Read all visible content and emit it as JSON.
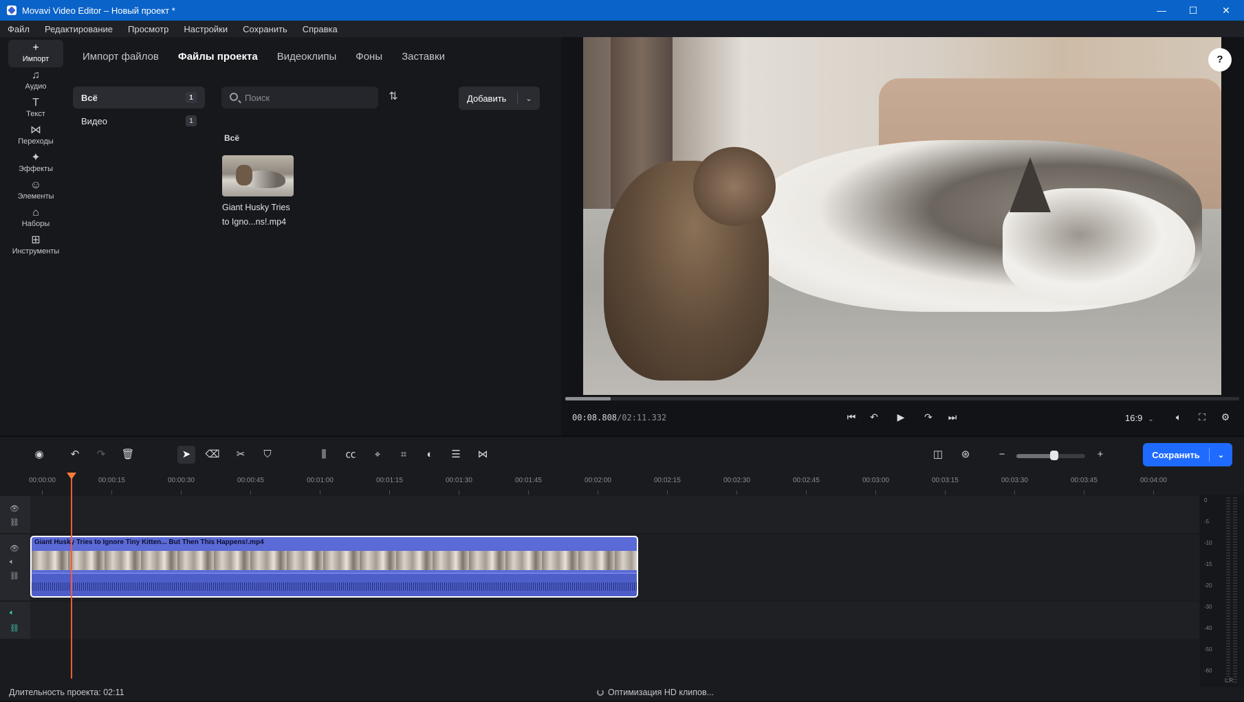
{
  "window": {
    "title": "Movavi Video Editor – Новый проект *",
    "minimize": "—",
    "maximize": "☐",
    "close": "✕"
  },
  "menu": [
    "Файл",
    "Редактирование",
    "Просмотр",
    "Настройки",
    "Сохранить",
    "Справка"
  ],
  "sidebar": [
    {
      "label": "Импорт",
      "icon": "plus-icon",
      "glyph": "+"
    },
    {
      "label": "Аудио",
      "icon": "music-note-icon",
      "glyph": "♫"
    },
    {
      "label": "Текст",
      "icon": "text-icon",
      "glyph": "T"
    },
    {
      "label": "Переходы",
      "icon": "transitions-icon",
      "glyph": "⋈"
    },
    {
      "label": "Эффекты",
      "icon": "magic-wand-icon",
      "glyph": "✦"
    },
    {
      "label": "Элементы",
      "icon": "smiley-icon",
      "glyph": "☺"
    },
    {
      "label": "Наборы",
      "icon": "bag-icon",
      "glyph": "⌂"
    },
    {
      "label": "Инструменты",
      "icon": "grid-tools-icon",
      "glyph": "⊞"
    }
  ],
  "tabs": [
    "Импорт файлов",
    "Файлы проекта",
    "Видеоклипы",
    "Фоны",
    "Заставки"
  ],
  "active_tab": "Файлы проекта",
  "categories": [
    {
      "label": "Всё",
      "count": "1"
    },
    {
      "label": "Видео",
      "count": "1"
    }
  ],
  "search": {
    "placeholder": "Поиск"
  },
  "add_button": "Добавить",
  "section_title": "Всё",
  "media": [
    {
      "name": "Giant Husky Tries to Igno...ns!.mp4"
    }
  ],
  "player": {
    "current": "00:08.808",
    "total": "/02:11.332",
    "progress": 0.067,
    "aspect": "16:9",
    "help": "?"
  },
  "timeline": {
    "save_label": "Сохранить",
    "zoom_level": 0.55,
    "ruler": [
      "00:00:00",
      "00:00:15",
      "00:00:30",
      "00:00:45",
      "00:01:00",
      "00:01:15",
      "00:01:30",
      "00:01:45",
      "00:02:00",
      "00:02:15",
      "00:02:30",
      "00:02:45",
      "00:03:00",
      "00:03:15",
      "00:03:30",
      "00:03:45",
      "00:04:00"
    ],
    "clip_title": "Giant Husky Tries to Ignore Tiny Kitten... But Then This Happens!.mp4",
    "meter_labels": [
      "0",
      "-5",
      "-10",
      "-15",
      "-20",
      "-30",
      "-40",
      "-50",
      "-60"
    ],
    "meter_lr": "L R"
  },
  "status": {
    "duration": "Длительность проекта: 02:11",
    "optimizing": "Оптимизация HD клипов..."
  },
  "colors": {
    "accent": "#1f6bff",
    "titlebar": "#0a63c9",
    "clip": "#5a6ad6",
    "playhead": "#ff5a3a"
  }
}
